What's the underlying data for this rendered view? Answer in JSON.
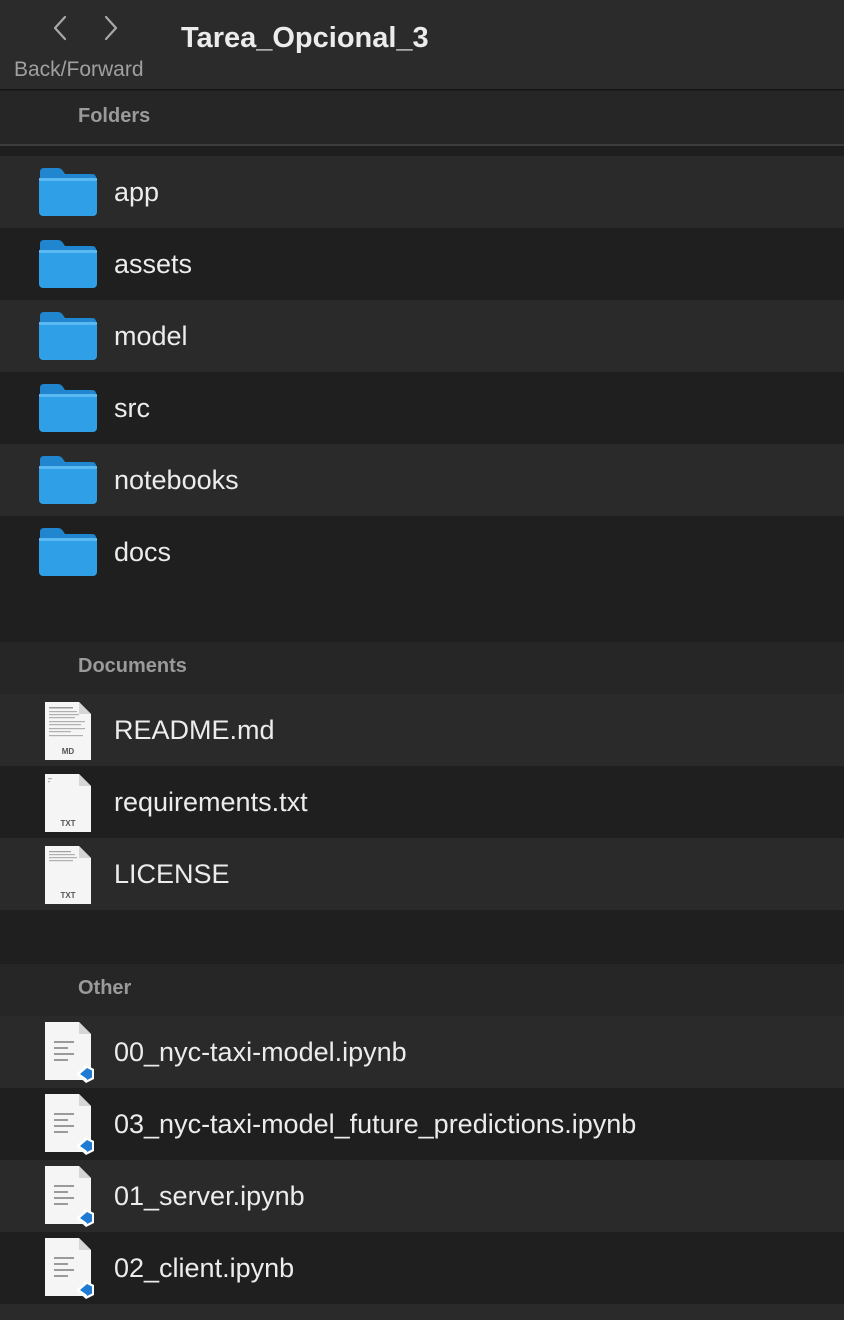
{
  "window": {
    "title": "Tarea_Opcional_3",
    "back_forward_label": "Back/Forward",
    "back_icon": "chevron-left",
    "forward_icon": "chevron-right"
  },
  "sections": [
    {
      "header": "Folders",
      "items": [
        {
          "name": "app",
          "icon": "folder-icon"
        },
        {
          "name": "assets",
          "icon": "folder-icon"
        },
        {
          "name": "model",
          "icon": "folder-icon"
        },
        {
          "name": "src",
          "icon": "folder-icon"
        },
        {
          "name": "notebooks",
          "icon": "folder-icon"
        },
        {
          "name": "docs",
          "icon": "folder-icon"
        }
      ]
    },
    {
      "header": "Documents",
      "items": [
        {
          "name": "README.md",
          "icon": "markdown-file-icon",
          "badge": "MD"
        },
        {
          "name": "requirements.txt",
          "icon": "text-file-icon",
          "badge": "TXT"
        },
        {
          "name": "LICENSE",
          "icon": "text-file-icon",
          "badge": "TXT"
        }
      ]
    },
    {
      "header": "Other",
      "items": [
        {
          "name": "00_nyc-taxi-model.ipynb",
          "icon": "notebook-file-icon"
        },
        {
          "name": "03_nyc-taxi-model_future_predictions.ipynb",
          "icon": "notebook-file-icon"
        },
        {
          "name": "01_server.ipynb",
          "icon": "notebook-file-icon"
        },
        {
          "name": "02_client.ipynb",
          "icon": "notebook-file-icon"
        }
      ]
    }
  ],
  "colors": {
    "folder_blue": "#2f9fe8",
    "folder_tab": "#1f86cf",
    "vscode_blue": "#1f7bd0",
    "background": "#1e1e1e",
    "row_alt": "#2a2a2a"
  }
}
